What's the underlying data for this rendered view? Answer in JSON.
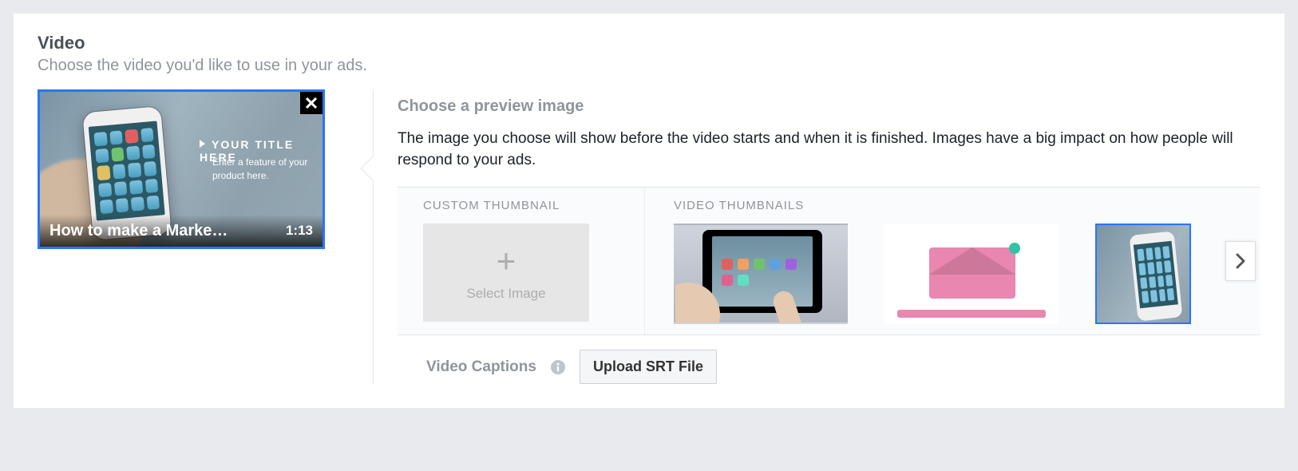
{
  "section": {
    "title": "Video",
    "subtitle": "Choose the video you'd like to use in your ads."
  },
  "selected_video": {
    "title": "How to make a Marke…",
    "duration": "1:13",
    "overlay_title": "YOUR TITLE HERE",
    "overlay_sub": "Enter a feature of your product here."
  },
  "preview": {
    "heading": "Choose a preview image",
    "description": "The image you choose will show before the video starts and when it is finished. Images have a big impact on how people will respond to your ads.",
    "custom_label": "CUSTOM THUMBNAIL",
    "select_image_label": "Select Image",
    "video_thumbs_label": "VIDEO THUMBNAILS"
  },
  "captions": {
    "label": "Video Captions",
    "button": "Upload SRT File"
  }
}
